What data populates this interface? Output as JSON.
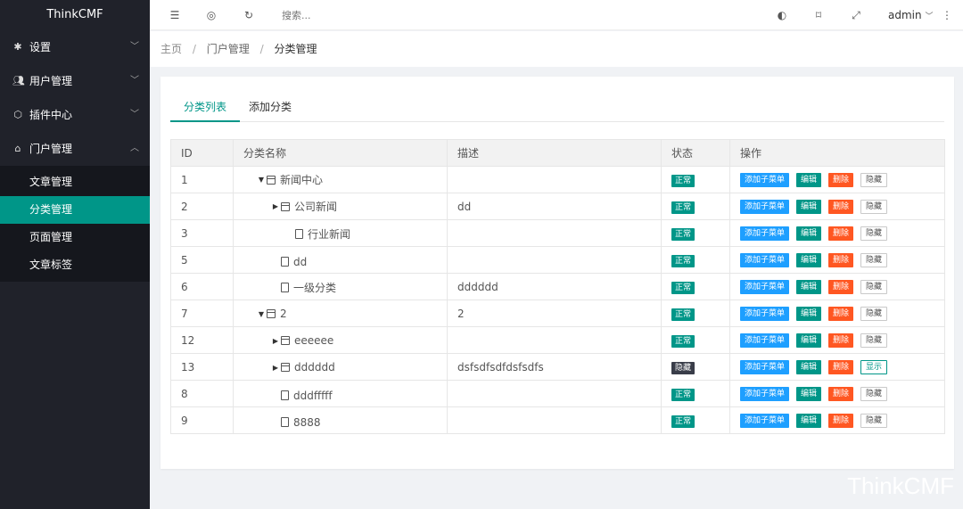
{
  "app": {
    "title": "ThinkCMF"
  },
  "sidebar": {
    "groups": [
      {
        "label": "设置",
        "icon": "gear-icon",
        "expanded": false
      },
      {
        "label": "用户管理",
        "icon": "users-icon",
        "expanded": false
      },
      {
        "label": "插件中心",
        "icon": "cube-icon",
        "expanded": false
      },
      {
        "label": "门户管理",
        "icon": "portal-icon",
        "expanded": true
      }
    ],
    "sub_items": [
      "文章管理",
      "分类管理",
      "页面管理",
      "文章标签"
    ],
    "active_sub": "分类管理"
  },
  "header": {
    "search_placeholder": "搜索...",
    "user": "admin"
  },
  "breadcrumb": [
    "主页",
    "门户管理",
    "分类管理"
  ],
  "tabs": [
    "分类列表",
    "添加分类"
  ],
  "table": {
    "headers": [
      "ID",
      "分类名称",
      "描述",
      "状态",
      "操作"
    ],
    "rows": [
      {
        "id": "1",
        "name": "新闻中心",
        "desc": "",
        "status": "正常",
        "toggle_label": "隐藏"
      },
      {
        "id": "2",
        "name": "公司新闻",
        "desc": "dd",
        "status": "正常",
        "toggle_label": "隐藏"
      },
      {
        "id": "3",
        "name": "行业新闻",
        "desc": "",
        "status": "正常",
        "toggle_label": "隐藏"
      },
      {
        "id": "5",
        "name": "dd",
        "desc": "",
        "status": "正常",
        "toggle_label": "隐藏"
      },
      {
        "id": "6",
        "name": "一级分类",
        "desc": "dddddd",
        "status": "正常",
        "toggle_label": "隐藏"
      },
      {
        "id": "7",
        "name": "2",
        "desc": "2",
        "status": "正常",
        "toggle_label": "隐藏"
      },
      {
        "id": "12",
        "name": "eeeeee",
        "desc": "",
        "status": "正常",
        "toggle_label": "隐藏"
      },
      {
        "id": "13",
        "name": "dddddd",
        "desc": "dsfsdfsdfdsfsdfs",
        "status": "隐藏",
        "toggle_label": "显示"
      },
      {
        "id": "8",
        "name": "dddfffff",
        "desc": "",
        "status": "正常",
        "toggle_label": "隐藏"
      },
      {
        "id": "9",
        "name": "8888",
        "desc": "",
        "status": "正常",
        "toggle_label": "隐藏"
      }
    ],
    "actions": {
      "add_child": "添加子菜单",
      "edit": "编辑",
      "delete": "删除"
    }
  },
  "watermark": "ThinkCMF",
  "colors": {
    "primary": "#009688",
    "sidebar": "#20222a",
    "blue": "#1e9fff",
    "danger": "#ff5722"
  }
}
